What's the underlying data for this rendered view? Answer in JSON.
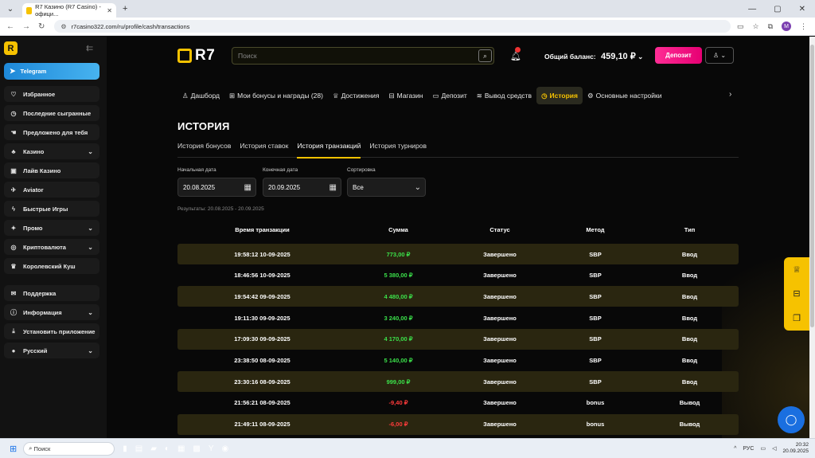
{
  "browser": {
    "tab_title": "R7 Казино (R7 Casino) - офици...",
    "url": "r7casino322.com/ru/profile/cash/transactions",
    "profile_initial": "M"
  },
  "sidebar": {
    "logo": "R",
    "telegram": "Telegram",
    "items": [
      {
        "label": "Избранное",
        "icon": "heart-icon",
        "glyph": "♡",
        "chev": ""
      },
      {
        "label": "Последние сыгранные",
        "icon": "clock-icon",
        "glyph": "◷",
        "chev": ""
      },
      {
        "label": "Предложено для тебя",
        "icon": "hand-icon",
        "glyph": "☚",
        "chev": ""
      },
      {
        "label": "Казино",
        "icon": "casino-icon",
        "glyph": "♣",
        "chev": "⌄"
      },
      {
        "label": "Лайв Казино",
        "icon": "live-icon",
        "glyph": "▣",
        "chev": ""
      },
      {
        "label": "Aviator",
        "icon": "plane-icon",
        "glyph": "✈",
        "chev": ""
      },
      {
        "label": "Быстрые Игры",
        "icon": "lightning-icon",
        "glyph": "ϟ",
        "chev": ""
      },
      {
        "label": "Промо",
        "icon": "gift-icon",
        "glyph": "✦",
        "chev": "⌄"
      },
      {
        "label": "Криптовалюта",
        "icon": "crypto-icon",
        "glyph": "◎",
        "chev": "⌄"
      },
      {
        "label": "Королевский Куш",
        "icon": "crown-icon",
        "glyph": "♛",
        "chev": ""
      },
      {
        "label": "Поддержка",
        "icon": "support-icon",
        "glyph": "✉",
        "chev": ""
      },
      {
        "label": "Информация",
        "icon": "info-icon",
        "glyph": "ⓘ",
        "chev": "⌄"
      },
      {
        "label": "Установить приложение",
        "icon": "download-icon",
        "glyph": "⤓",
        "chev": ""
      },
      {
        "label": "Русский",
        "icon": "flag-ru-icon",
        "glyph": "●",
        "chev": "⌄"
      }
    ]
  },
  "header": {
    "logo_text": "R7",
    "search_placeholder": "Поиск",
    "balance_label": "Общий баланс:",
    "balance_amount": "459,10 ₽",
    "deposit_button": "Депозит"
  },
  "nav_tabs": [
    {
      "label": "Дашборд",
      "icon": "user-icon",
      "glyph": "♙"
    },
    {
      "label": "Мои бонусы и награды (28)",
      "icon": "gift-icon",
      "glyph": "⊞"
    },
    {
      "label": "Достижения",
      "icon": "trophy-icon",
      "glyph": "♕"
    },
    {
      "label": "Магазин",
      "icon": "store-icon",
      "glyph": "⊟"
    },
    {
      "label": "Депозит",
      "icon": "wallet-icon",
      "glyph": "▭"
    },
    {
      "label": "Вывод средств",
      "icon": "coins-icon",
      "glyph": "≋"
    },
    {
      "label": "История",
      "icon": "history-icon",
      "glyph": "◷"
    },
    {
      "label": "Основные настройки",
      "icon": "gear-icon",
      "glyph": "⚙"
    }
  ],
  "page_title": "ИСТОРИЯ",
  "sub_tabs": [
    "История бонусов",
    "История ставок",
    "История транзакций",
    "История турниров"
  ],
  "filters": {
    "start_label": "Начальная дата",
    "start_value": "20.08.2025",
    "end_label": "Конечная дата",
    "end_value": "20.09.2025",
    "sort_label": "Сортировка",
    "sort_value": "Все"
  },
  "results_text": "Результаты: 20.08.2025 - 20.09.2025",
  "table": {
    "headers": [
      "Время транзакции",
      "Сумма",
      "Статус",
      "Метод",
      "Тип"
    ],
    "rows": [
      {
        "time": "19:58:12 10-09-2025",
        "amount": "773,00 ₽",
        "sign": "pos",
        "status": "Завершено",
        "method": "SBP",
        "type": "Ввод"
      },
      {
        "time": "18:46:56 10-09-2025",
        "amount": "5 380,00 ₽",
        "sign": "pos",
        "status": "Завершено",
        "method": "SBP",
        "type": "Ввод"
      },
      {
        "time": "19:54:42 09-09-2025",
        "amount": "4 480,00 ₽",
        "sign": "pos",
        "status": "Завершено",
        "method": "SBP",
        "type": "Ввод"
      },
      {
        "time": "19:11:30 09-09-2025",
        "amount": "3 240,00 ₽",
        "sign": "pos",
        "status": "Завершено",
        "method": "SBP",
        "type": "Ввод"
      },
      {
        "time": "17:09:30 09-09-2025",
        "amount": "4 170,00 ₽",
        "sign": "pos",
        "status": "Завершено",
        "method": "SBP",
        "type": "Ввод"
      },
      {
        "time": "23:38:50 08-09-2025",
        "amount": "5 140,00 ₽",
        "sign": "pos",
        "status": "Завершено",
        "method": "SBP",
        "type": "Ввод"
      },
      {
        "time": "23:30:16 08-09-2025",
        "amount": "999,00 ₽",
        "sign": "pos",
        "status": "Завершено",
        "method": "SBP",
        "type": "Ввод"
      },
      {
        "time": "21:56:21 08-09-2025",
        "amount": "-9,40 ₽",
        "sign": "neg",
        "status": "Завершено",
        "method": "bonus",
        "type": "Вывод"
      },
      {
        "time": "21:49:11 08-09-2025",
        "amount": "-6,00 ₽",
        "sign": "neg",
        "status": "Завершено",
        "method": "bonus",
        "type": "Вывод"
      }
    ]
  },
  "taskbar": {
    "search": "Поиск",
    "lang": "РУС",
    "time": "20:32",
    "date": "20.09.2025"
  },
  "colors": {
    "accent": "#f6c200",
    "deposit": "#ff2d95",
    "positive": "#3be04a",
    "negative": "#ff3b3b",
    "row_highlight": "#2a2610"
  }
}
